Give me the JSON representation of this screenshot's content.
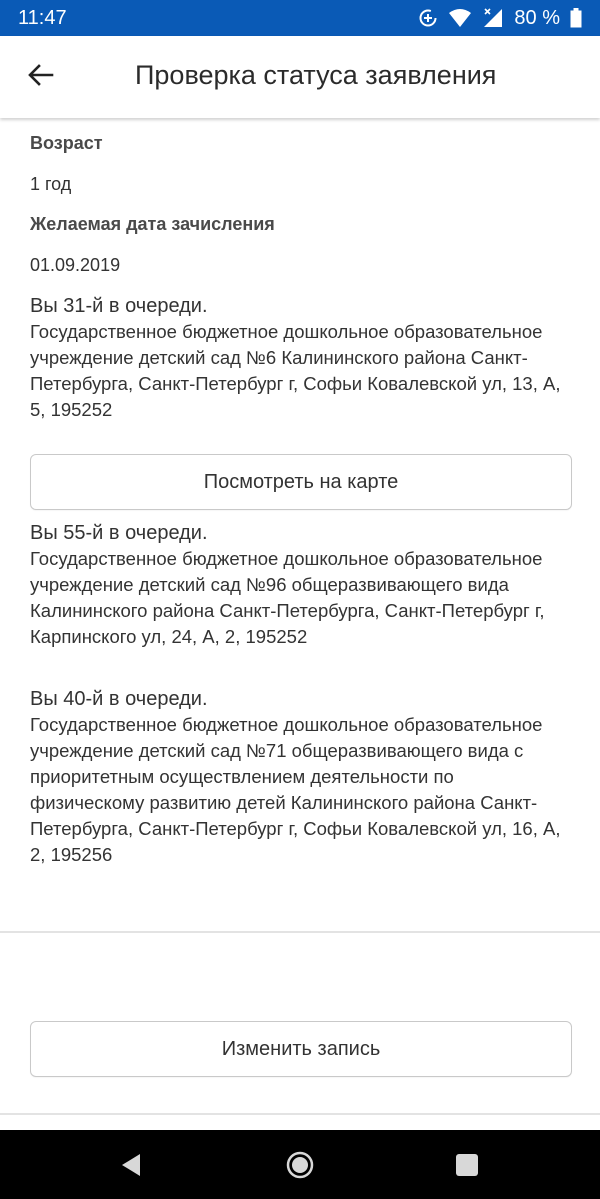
{
  "status_bar": {
    "time": "11:47",
    "battery": "80 %",
    "icons": [
      "data-saver-icon",
      "wifi-icon",
      "signal-icon",
      "battery-icon"
    ]
  },
  "header": {
    "title": "Проверка статуса заявления",
    "back_icon": "arrow-left-icon"
  },
  "details": {
    "age_label": "Возраст",
    "age_value": "1 год",
    "date_label": "Желаемая дата зачисления",
    "date_value": "01.09.2019"
  },
  "queues": [
    {
      "position": "Вы 31-й в очереди.",
      "institution": "Государственное бюджетное дошкольное образовательное учреждение детский сад №6 Калининского района Санкт-Петербурга, Санкт-Петербург г, Софьи Ковалевской ул, 13, А, 5, 195252"
    },
    {
      "position": "Вы 55-й в очереди.",
      "institution": "Государственное бюджетное дошкольное образовательное учреждение детский сад №96 общеразвивающего вида Калининского района Санкт-Петербурга, Санкт-Петербург г, Карпинского ул, 24, А, 2, 195252"
    },
    {
      "position": "Вы 40-й в очереди.",
      "institution": "Государственное бюджетное дошкольное образовательное учреждение детский сад №71 общеразвивающего вида с приоритетным осуществлением деятельности по физическому развитию детей Калининского района Санкт-Петербурга, Санкт-Петербург г, Софьи Ковалевской ул, 16, А, 2, 195256"
    }
  ],
  "buttons": {
    "map_label": "Посмотреть на карте",
    "edit_label": "Изменить запись"
  },
  "colors": {
    "status_bar": "#0a5ab6",
    "text": "#333333",
    "border": "#c9c9c9"
  },
  "nav_bar": {
    "icons": [
      "back-triangle-icon",
      "home-circle-icon",
      "recents-square-icon"
    ]
  }
}
